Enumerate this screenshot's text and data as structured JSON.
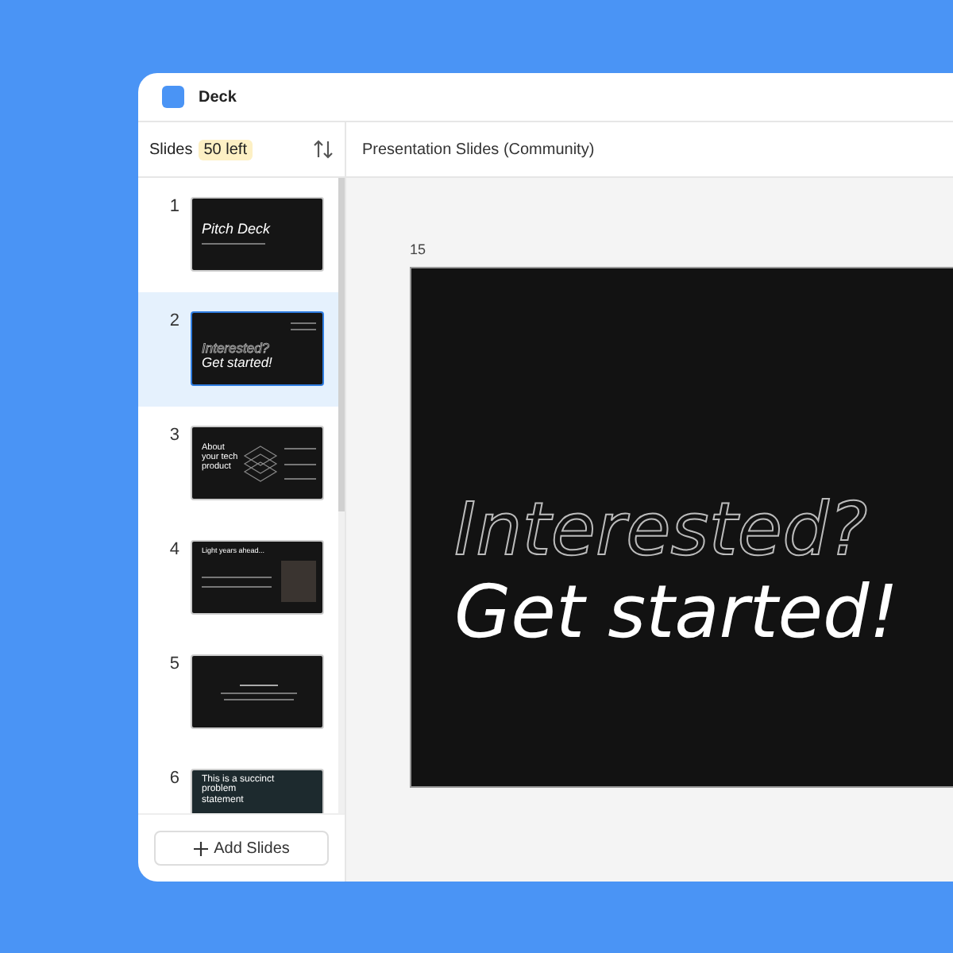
{
  "window": {
    "title": "Deck"
  },
  "sidebar": {
    "title": "Slides",
    "badge": "50 left",
    "add_button": "Add Slides",
    "slides": [
      {
        "number": "1",
        "selected": false,
        "kind": "title",
        "heading": [
          "Pitch Deck"
        ]
      },
      {
        "number": "2",
        "selected": true,
        "kind": "outline",
        "heading": [
          "Interested?",
          "Get started!"
        ]
      },
      {
        "number": "3",
        "selected": false,
        "kind": "feature",
        "heading": [
          "About your tech product"
        ]
      },
      {
        "number": "4",
        "selected": false,
        "kind": "photo",
        "heading": [
          "Light years ahead..."
        ]
      },
      {
        "number": "5",
        "selected": false,
        "kind": "centered"
      },
      {
        "number": "6",
        "selected": false,
        "kind": "photo-title",
        "heading": [
          "This is a succinct problem statement"
        ]
      }
    ]
  },
  "document": {
    "title": "Presentation Slides (Community)"
  },
  "canvas": {
    "slide_number": "15",
    "outline_text": "Interested?",
    "headline": "Get started!"
  }
}
